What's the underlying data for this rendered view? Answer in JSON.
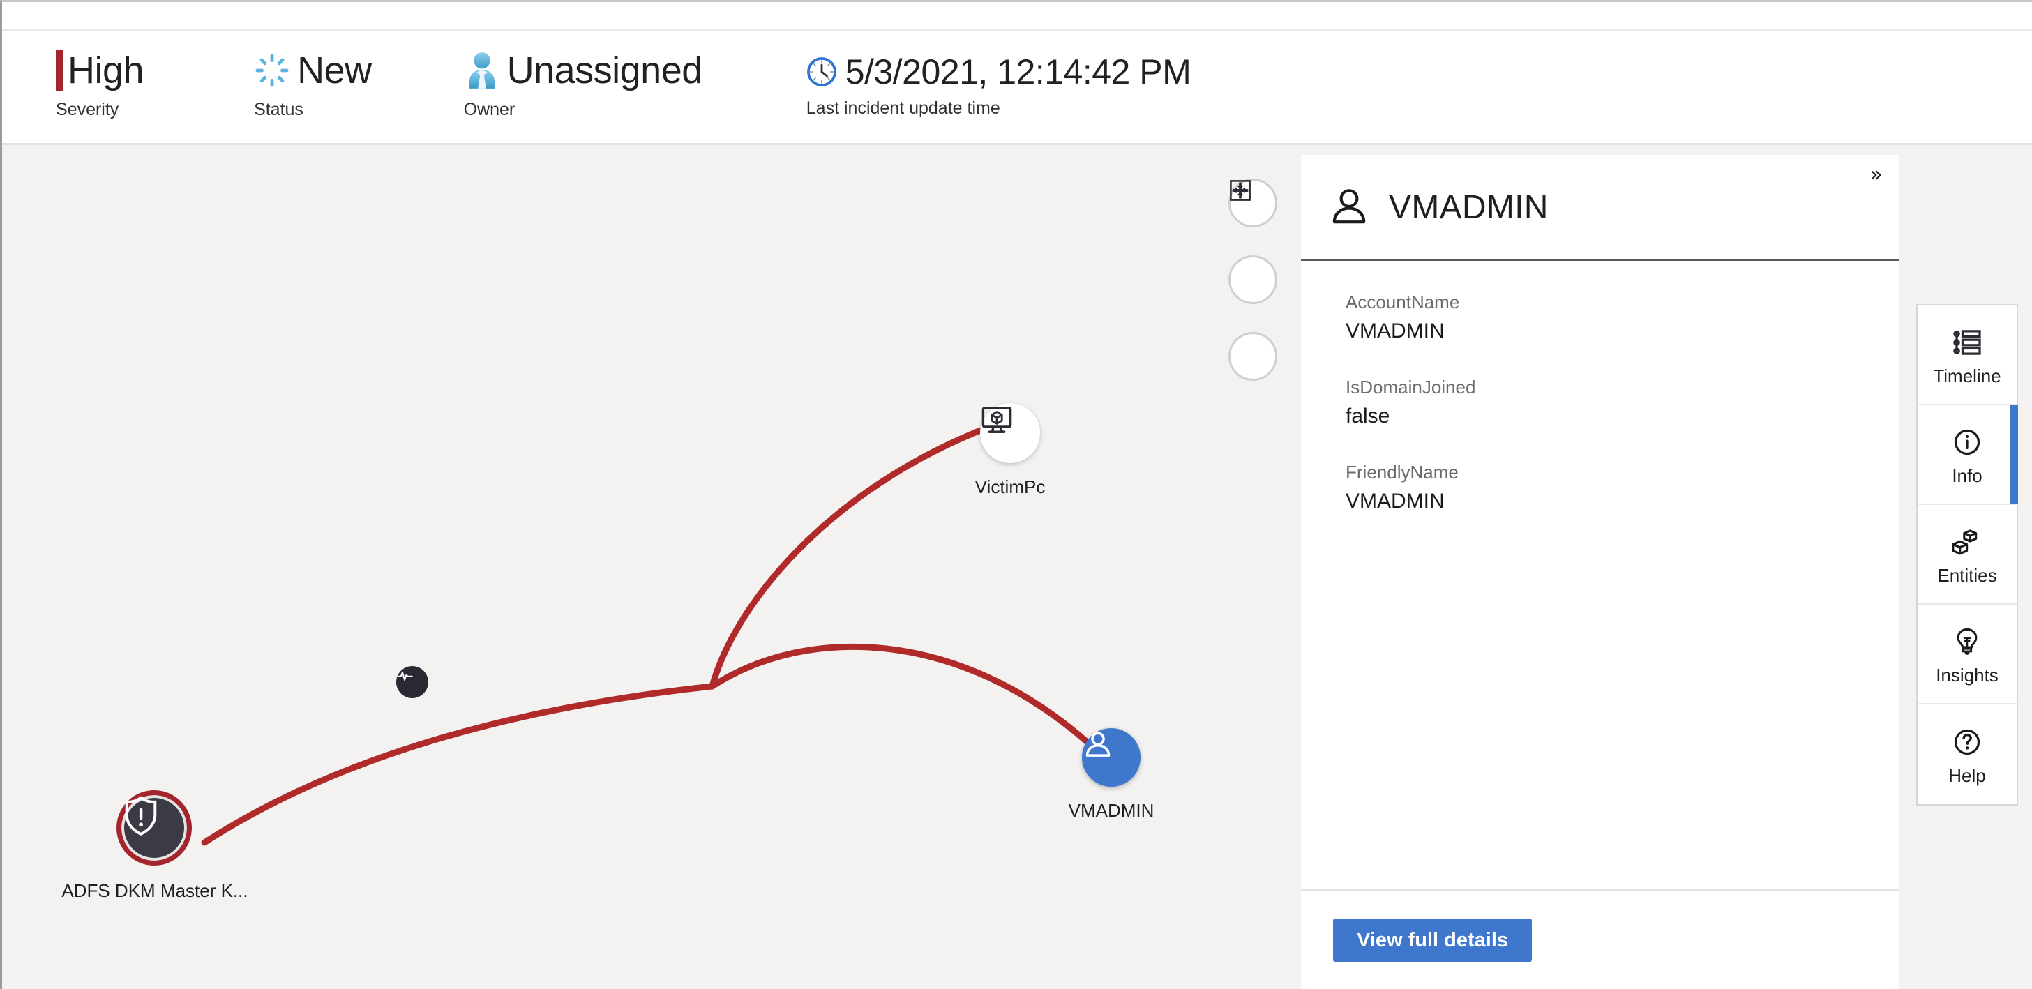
{
  "header": {
    "items": [
      {
        "icon": "severity-bar-icon",
        "value": "High",
        "label": "Severity"
      },
      {
        "icon": "status-spinner-icon",
        "value": "New",
        "label": "Status"
      },
      {
        "icon": "owner-person-icon",
        "value": "Unassigned",
        "label": "Owner"
      },
      {
        "icon": "clock-icon",
        "value": "5/3/2021, 12:14:42 PM",
        "label": "Last incident update time"
      }
    ],
    "severity_color": "#a4262c",
    "status_color": "#5bb3e0",
    "owner_color": "#5fb4e0"
  },
  "graph": {
    "nodes": [
      {
        "id": "alert",
        "label": "ADFS DKM Master K...",
        "icon": "shield-alert-icon",
        "type": "alert"
      },
      {
        "id": "victimpc",
        "label": "VictimPc",
        "icon": "host-monitor-icon",
        "type": "host"
      },
      {
        "id": "vmadmin",
        "label": "VMADMIN",
        "icon": "account-person-icon",
        "type": "account"
      },
      {
        "id": "activity",
        "label": "",
        "icon": "pulse-activity-icon",
        "type": "activity"
      }
    ],
    "edge_color": "#b02a2a",
    "canvas_color": "#f3f2f1",
    "zoom_controls": [
      {
        "name": "fit-to-view-button",
        "icon": "fit-to-view-icon"
      },
      {
        "name": "zoom-in-button",
        "icon": "plus-icon"
      },
      {
        "name": "zoom-out-button",
        "icon": "minus-icon"
      }
    ]
  },
  "details": {
    "collapse_glyph": "»",
    "title": "VMADMIN",
    "title_icon": "account-person-icon",
    "fields": [
      {
        "key": "AccountName",
        "value": "VMADMIN"
      },
      {
        "key": "IsDomainJoined",
        "value": "false"
      },
      {
        "key": "FriendlyName",
        "value": "VMADMIN"
      }
    ],
    "footer": {
      "button_label": "View full details",
      "button_color": "#3f77cd"
    }
  },
  "rail": {
    "active_color": "#3f77cd",
    "items": [
      {
        "label": "Timeline",
        "icon": "timeline-list-icon",
        "active": false
      },
      {
        "label": "Info",
        "icon": "info-circle-icon",
        "active": true
      },
      {
        "label": "Entities",
        "icon": "entities-cubes-icon",
        "active": false
      },
      {
        "label": "Insights",
        "icon": "lightbulb-icon",
        "active": false
      },
      {
        "label": "Help",
        "icon": "question-circle-icon",
        "active": false
      }
    ]
  }
}
